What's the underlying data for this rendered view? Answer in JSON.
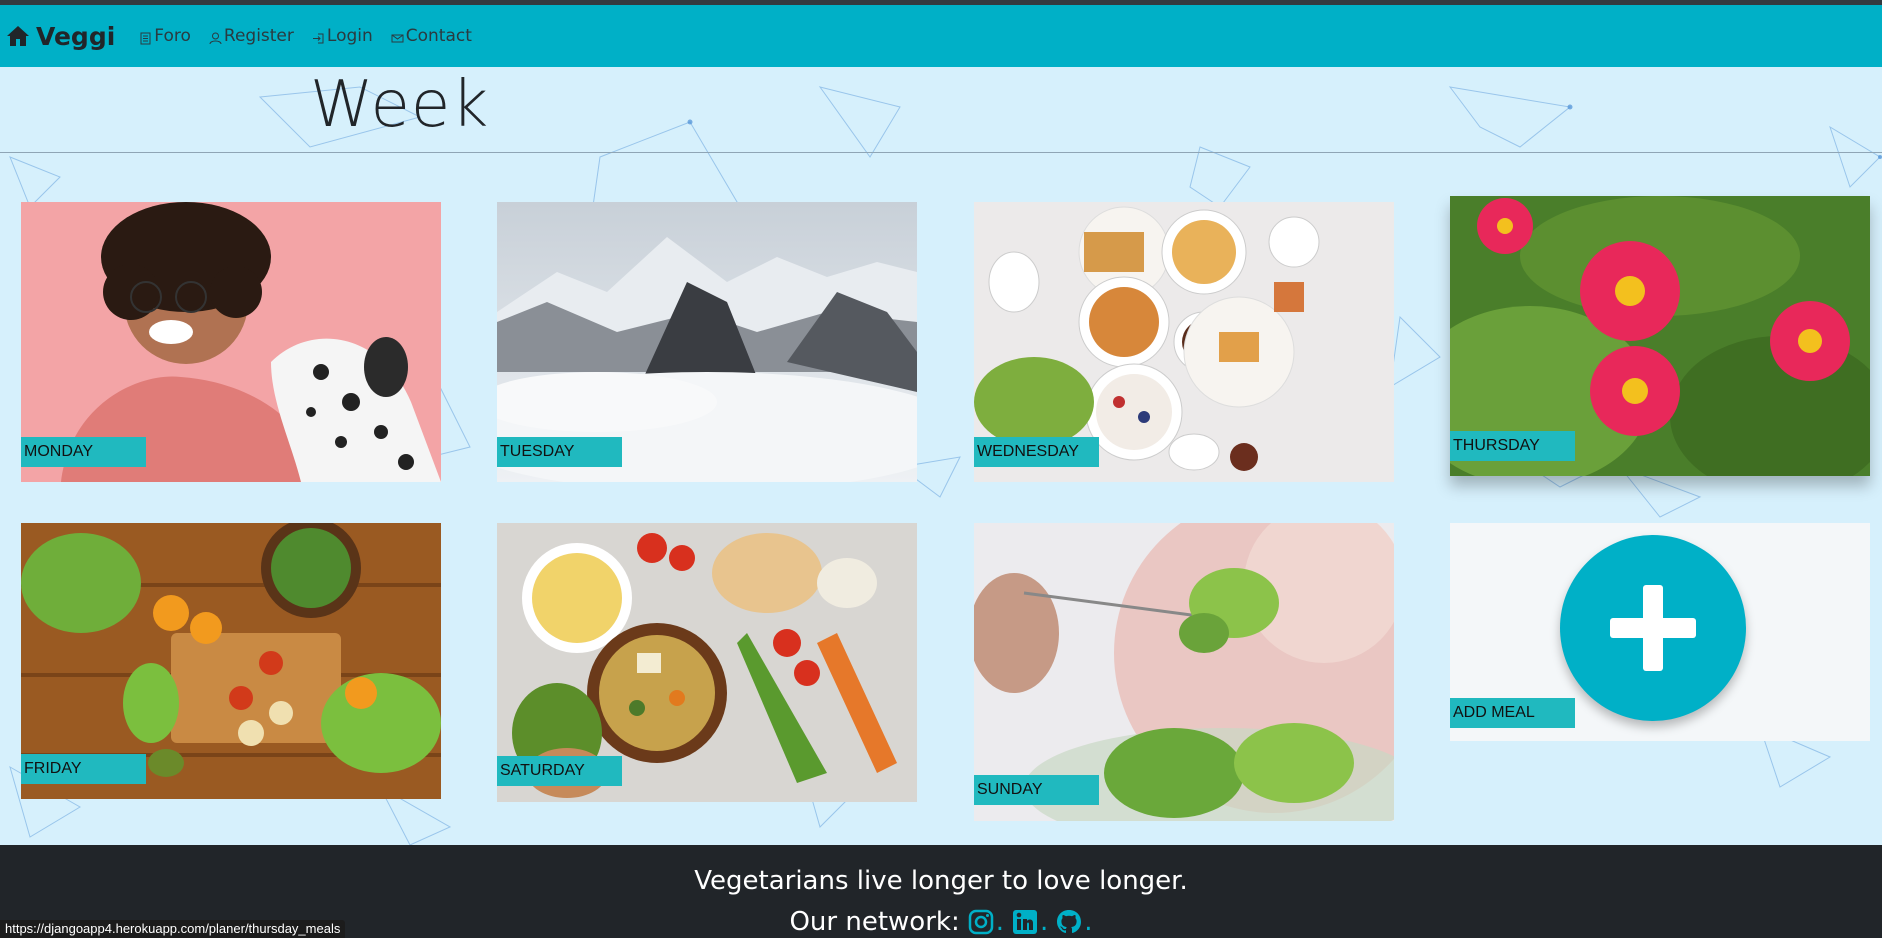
{
  "navbar": {
    "brand": "Veggi",
    "links": [
      {
        "label": "Foro",
        "icon": "document-icon"
      },
      {
        "label": "Register",
        "icon": "user-icon"
      },
      {
        "label": "Login",
        "icon": "login-icon"
      },
      {
        "label": "Contact",
        "icon": "envelope-icon"
      }
    ]
  },
  "page": {
    "title": "Week"
  },
  "days": [
    {
      "label": "MONDAY",
      "photo": "woman-with-dalmatian"
    },
    {
      "label": "TUESDAY",
      "photo": "snowy-mountains"
    },
    {
      "label": "WEDNESDAY",
      "photo": "breakfast-table"
    },
    {
      "label": "THURSDAY",
      "photo": "pink-flowers"
    },
    {
      "label": "FRIDAY",
      "photo": "vegetables-on-wooden-table"
    },
    {
      "label": "SATURDAY",
      "photo": "vegetable-bowl-spread"
    },
    {
      "label": "SUNDAY",
      "photo": "salad-on-fork"
    }
  ],
  "add_meal": {
    "label": "ADD MEAL",
    "icon": "plus-icon"
  },
  "footer": {
    "tagline": "Vegetarians live longer to love longer.",
    "network_label": "Our network:",
    "social_icons": [
      "instagram-icon",
      "linkedin-icon",
      "github-icon"
    ]
  },
  "status_bar": {
    "url": "https://djangoapp4.herokuapp.com/planer/thursday_meals"
  },
  "colors": {
    "accent": "#00b0c7",
    "label_bg": "#20b9bf",
    "page_bg": "#d6f0fc",
    "footer_bg": "#212529"
  }
}
